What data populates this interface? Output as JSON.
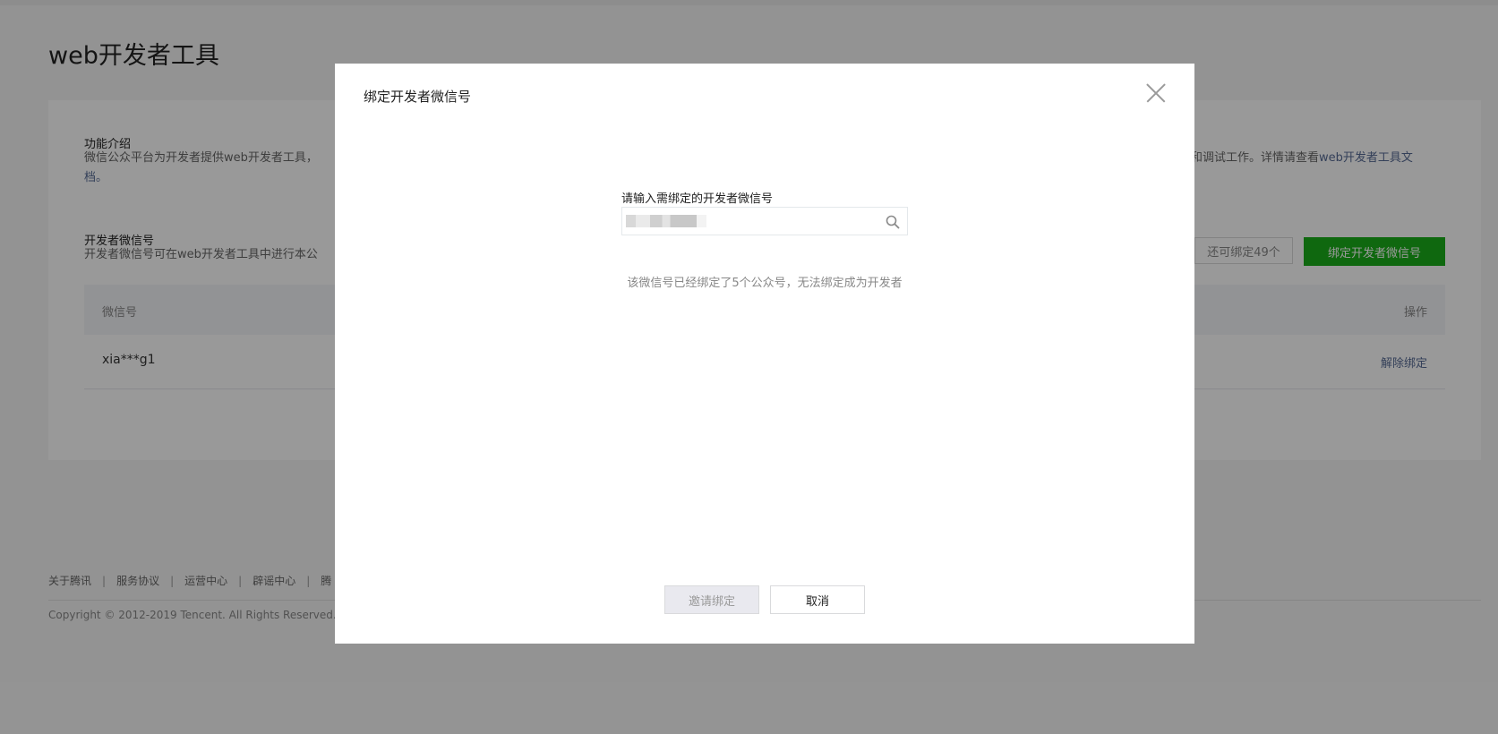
{
  "page": {
    "title": "web开发者工具",
    "intro_title": "功能介绍",
    "intro_desc_start": "微信公众平台为开发者提供web开发者工具，",
    "intro_desc_end": "和调试工作。详情请查看",
    "intro_link": "web开发者工具文",
    "intro_link_tail": "档。",
    "dev_title": "开发者微信号",
    "dev_desc": "开发者微信号可在web开发者工具中进行本公",
    "quota_button": "还可绑定49个",
    "bind_button": "绑定开发者微信号",
    "table": {
      "col_wechat": "微信号",
      "col_action": "操作",
      "rows": [
        {
          "wechat": "xia***g1",
          "action": "解除绑定"
        }
      ]
    }
  },
  "footer": {
    "links": [
      "关于腾讯",
      "服务协议",
      "运营中心",
      "辟谣中心",
      "腾"
    ],
    "copyright": "Copyright © 2012-2019 Tencent. All Rights Reserved."
  },
  "dialog": {
    "title": "绑定开发者微信号",
    "field_label": "请输入需绑定的开发者微信号",
    "input_value": "",
    "error_message": "该微信号已经绑定了5个公众号，无法绑定成为开发者",
    "invite_button": "邀请绑定",
    "cancel_button": "取消"
  },
  "colors": {
    "primary_green": "#1aad19",
    "link_blue": "#576b95",
    "mask": "rgba(0,0,0,0.4)"
  },
  "icons": {
    "close": "close-icon",
    "search": "search-icon"
  }
}
